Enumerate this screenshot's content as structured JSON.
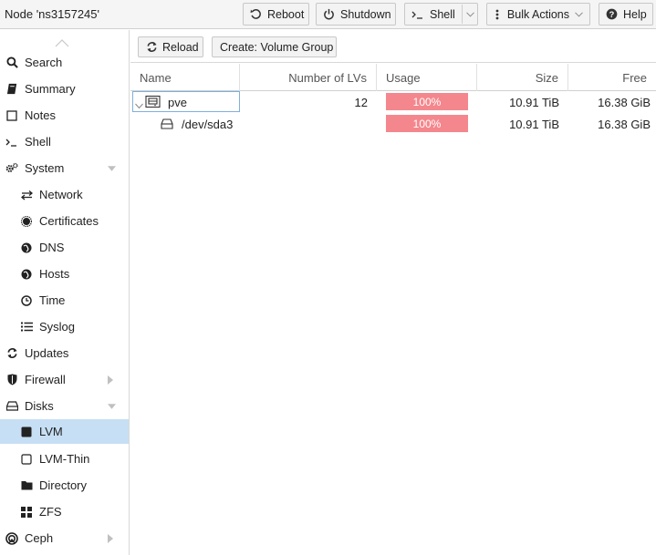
{
  "header": {
    "node_title": "Node 'ns3157245'",
    "reboot_label": "Reboot",
    "shutdown_label": "Shutdown",
    "shell_label": "Shell",
    "bulk_actions_label": "Bulk Actions",
    "help_label": "Help"
  },
  "sidebar": {
    "items": [
      {
        "label": "Search",
        "icon": "search-icon"
      },
      {
        "label": "Summary",
        "icon": "book-icon"
      },
      {
        "label": "Notes",
        "icon": "note-icon"
      },
      {
        "label": "Shell",
        "icon": "terminal-icon"
      },
      {
        "label": "System",
        "icon": "gears-icon"
      },
      {
        "label": "Network",
        "icon": "exchange-icon"
      },
      {
        "label": "Certificates",
        "icon": "certificate-icon"
      },
      {
        "label": "DNS",
        "icon": "globe-icon"
      },
      {
        "label": "Hosts",
        "icon": "globe-icon"
      },
      {
        "label": "Time",
        "icon": "clock-icon"
      },
      {
        "label": "Syslog",
        "icon": "list-icon"
      },
      {
        "label": "Updates",
        "icon": "refresh-icon"
      },
      {
        "label": "Firewall",
        "icon": "shield-icon"
      },
      {
        "label": "Disks",
        "icon": "hdd-icon"
      },
      {
        "label": "LVM",
        "icon": "square-icon"
      },
      {
        "label": "LVM-Thin",
        "icon": "square-outline-icon"
      },
      {
        "label": "Directory",
        "icon": "folder-icon"
      },
      {
        "label": "ZFS",
        "icon": "th-large-icon"
      },
      {
        "label": "Ceph",
        "icon": "ceph-icon"
      }
    ],
    "active": "LVM"
  },
  "toolbar": {
    "reload_label": "Reload",
    "create_label": "Create: Volume Group"
  },
  "grid": {
    "columns": {
      "name": "Name",
      "lvs": "Number of LVs",
      "usage": "Usage",
      "size": "Size",
      "free": "Free"
    },
    "rows": [
      {
        "name": "pve",
        "lvs": "12",
        "usage": "100%",
        "usage_fraction": 1.0,
        "size": "10.91 TiB",
        "free": "16.38 GiB"
      },
      {
        "name": "/dev/sda3",
        "lvs": "",
        "usage": "100%",
        "usage_fraction": 1.0,
        "size": "10.91 TiB",
        "free": "16.38 GiB"
      }
    ]
  },
  "colors": {
    "active_nav": "#c6dff4",
    "usage_critical": "#f4878d"
  }
}
